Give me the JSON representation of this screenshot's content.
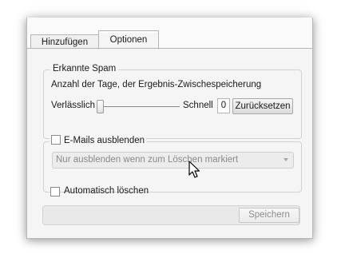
{
  "tabs": {
    "add_label": "Hinzufügen",
    "options_label": "Optionen"
  },
  "spam_group": {
    "title": "Erkannte Spam",
    "description": "Anzahl der Tage, der Ergebnis-Zwischespeicherung",
    "slider_min_label": "Verlässlich",
    "slider_max_label": "Schnell",
    "slider_value": "0",
    "reset_button_label": "Zurücksetzen"
  },
  "hide_emails": {
    "checkbox_label": "E-Mails ausblenden",
    "checked": false,
    "dropdown_value": "Nur ausblenden wenn zum Löschen markiert"
  },
  "auto_delete": {
    "checkbox_label": "Automatisch löschen",
    "checked": false
  },
  "save_button_label": "Speichern",
  "colors": {
    "window_bg": "#f5f5f5",
    "border": "#b4b4b4",
    "disabled_text": "#8c8c8c"
  },
  "icons": [
    "chevron-down-icon",
    "mouse-pointer-icon"
  ]
}
